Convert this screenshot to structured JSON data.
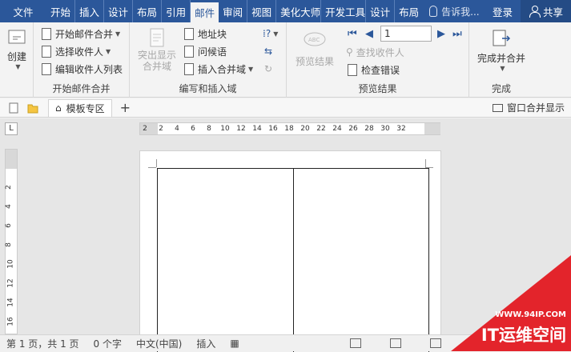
{
  "tabs": {
    "file": "文件",
    "items": [
      "开始",
      "插入",
      "设计",
      "布局",
      "引用",
      "邮件",
      "审阅",
      "视图",
      "美化大师",
      "开发工具",
      "设计",
      "布局"
    ],
    "active_index": 5,
    "tell": "告诉我...",
    "login": "登录",
    "share": "共享"
  },
  "ribbon": {
    "create": {
      "label": "创建",
      "group": ""
    },
    "start": {
      "group": "开始邮件合并",
      "items": [
        "开始邮件合并",
        "选择收件人",
        "编辑收件人列表"
      ]
    },
    "write": {
      "group": "编写和插入域",
      "highlight": "突出显示合并域",
      "items": [
        "地址块",
        "问候语",
        "插入合并域"
      ]
    },
    "preview": {
      "group": "预览结果",
      "preview_label": "预览结果",
      "record": "1",
      "find": "查找收件人",
      "check": "检查错误"
    },
    "finish": {
      "group": "完成",
      "label": "完成并合并"
    }
  },
  "doctabs": {
    "template": "模板专区",
    "merge_window": "窗口合并显示"
  },
  "ruler": {
    "h_ticks": [
      "2",
      "2",
      "4",
      "6",
      "8",
      "10",
      "12",
      "14",
      "16",
      "18",
      "20",
      "22",
      "24",
      "26",
      "28",
      "30",
      "32"
    ],
    "v_ticks": [
      "2",
      "4",
      "6",
      "8",
      "10",
      "12",
      "14",
      "16"
    ]
  },
  "status": {
    "page": "第 1 页，共 1 页",
    "words": "0 个字",
    "lang": "中文(中国)",
    "mode": "插入"
  },
  "watermark": {
    "url": "WWW.94IP.COM",
    "brand": "IT运维空间"
  }
}
